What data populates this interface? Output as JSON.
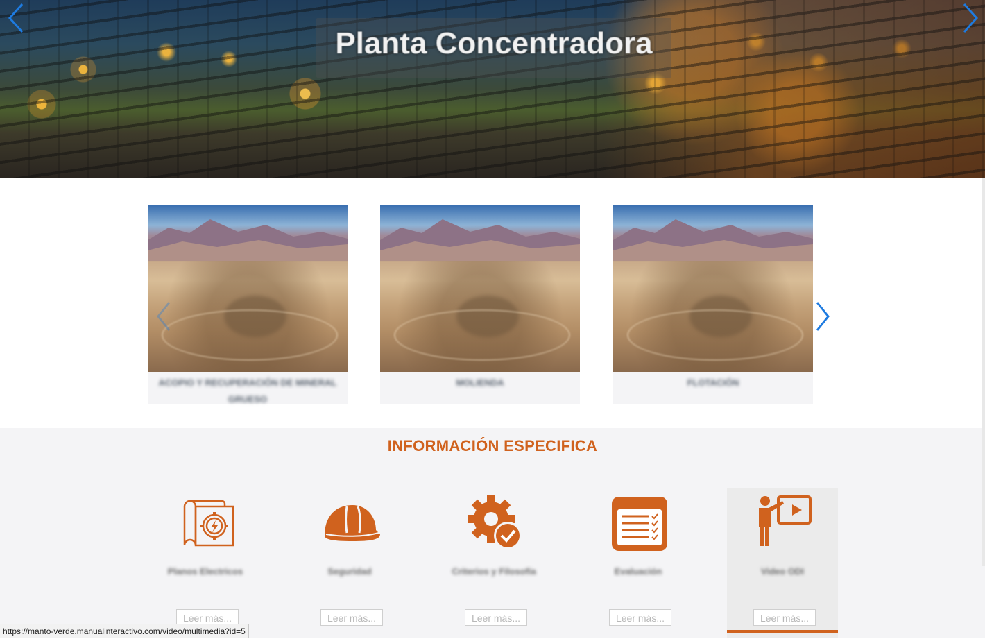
{
  "hero": {
    "title": "Planta Concentradora",
    "prev_icon": "chevron-left-icon",
    "next_icon": "chevron-right-icon"
  },
  "carousel": {
    "cards": [
      {
        "caption": "ACOPIO Y RECUPERACIÓN DE MINERAL GRUESO"
      },
      {
        "caption": "MOLIENDA"
      },
      {
        "caption": "FLOTACIÓN"
      }
    ],
    "prev_icon": "chevron-left-icon",
    "next_icon": "chevron-right-icon"
  },
  "info": {
    "title": "INFORMACIÓN ESPECIFICA",
    "tiles": [
      {
        "icon": "blueprint-electric-icon",
        "label": "Planos Electricos",
        "button": "Leer más..."
      },
      {
        "icon": "hard-hat-icon",
        "label": "Seguridad",
        "button": "Leer más..."
      },
      {
        "icon": "gear-check-icon",
        "label": "Criterios y Filosofía",
        "button": "Leer más..."
      },
      {
        "icon": "checklist-icon",
        "label": "Evaluación",
        "button": "Leer más..."
      },
      {
        "icon": "presenter-video-icon",
        "label": "Video ODI",
        "button": "Leer más..."
      }
    ]
  },
  "status_url": "https://manto-verde.manualinteractivo.com/video/multimedia?id=5",
  "colors": {
    "accent": "#d0621e",
    "arrow": "#1e7be0"
  }
}
